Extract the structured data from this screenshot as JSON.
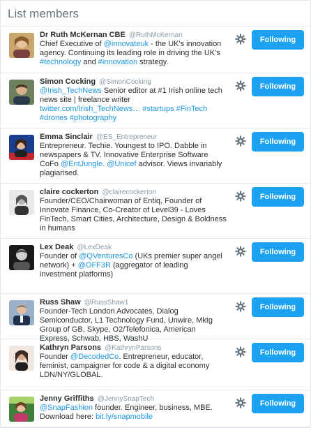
{
  "header": {
    "title": "List members"
  },
  "button_label": "Following",
  "colors": {
    "accent": "#1da1f2",
    "link": "#1b95e0",
    "handle": "#8899a6",
    "text": "#292f33"
  },
  "members": [
    {
      "name": "Dr Ruth McKernan CBE",
      "handle": "@RuthMcKernan",
      "bio": [
        [
          "Chief Executive of ",
          false
        ],
        [
          "@innovateuk",
          true
        ],
        [
          " - the UK's innovation agency. Continuing its leading role in driving the UK's ",
          false
        ],
        [
          "#technology",
          true
        ],
        [
          " and ",
          false
        ],
        [
          "#innovation",
          true
        ],
        [
          " strategy.",
          false
        ]
      ],
      "avatar_icon": "woman-portrait-avatar"
    },
    {
      "name": "Simon Cocking",
      "handle": "@SimonCocking",
      "bio": [
        [
          "@Irish_TechNews",
          true
        ],
        [
          " Senior editor at #1 Irish online tech news site | freelance writer ",
          false
        ],
        [
          "twitter.com/Irish_TechNews…",
          true
        ],
        [
          " ",
          false
        ],
        [
          "#startups",
          true
        ],
        [
          " ",
          false
        ],
        [
          "#FinTech",
          true
        ],
        [
          " ",
          false
        ],
        [
          "#drones",
          true
        ],
        [
          " ",
          false
        ],
        [
          "#photography",
          true
        ]
      ],
      "avatar_icon": "man-portrait-avatar"
    },
    {
      "name": "Emma Sinclair",
      "handle": "@ES_Entrepreneur",
      "bio": [
        [
          "Entrepreneur. Techie. Youngest to IPO. Dabble in newspapers & TV. Innovative Enterprise Software CoFo ",
          false
        ],
        [
          "@EntJungle",
          true
        ],
        [
          ". ",
          false
        ],
        [
          "@Unicef",
          true
        ],
        [
          " advisor. Views invariably plagiarised.",
          false
        ]
      ],
      "avatar_icon": "woman-tv-avatar"
    },
    {
      "name": "claire cockerton",
      "handle": "@clairecockerton",
      "bio": [
        [
          "Founder/CEO/Chairwoman of Entiq, Founder of Innovate Finance, Co-Creator of Level39 - Loves FinTech, Smart Cities, Architecture, Design & Boldness in humans",
          false
        ]
      ],
      "avatar_icon": "woman-bw-avatar"
    },
    {
      "name": "Lex Deak",
      "handle": "@LexDeak",
      "bio": [
        [
          "Founder of ",
          false
        ],
        [
          "@QVenturesCo",
          true
        ],
        [
          " (UKs premier super angel network) + ",
          false
        ],
        [
          "@OFF3R",
          true
        ],
        [
          " (aggregator of leading investment platforms)",
          false
        ]
      ],
      "avatar_icon": "man-bw-avatar"
    },
    {
      "name": "Russ Shaw",
      "handle": "@RussShaw1",
      "bio": [
        [
          "Founder-Tech London Advocates, Dialog Semiconductor, L1 Technology Fund, Unwire, Mktg Group of GB, Skype, O2/Telefonica, American Express, Schwab, HBS, WashU",
          false
        ]
      ],
      "avatar_icon": "man-suit-avatar"
    },
    {
      "name": "Kathryn Parsons",
      "handle": "@KathrynParsons",
      "bio": [
        [
          "Founder ",
          false
        ],
        [
          "@DecodedCo",
          true
        ],
        [
          ". Entrepreneur, educator, feminist, campaigner for code & a digital economy LDN/NY/GLOBAL.",
          false
        ]
      ],
      "avatar_icon": "woman-dark-avatar"
    },
    {
      "name": "Jenny Griffiths",
      "handle": "@JennySnapTech",
      "bio": [
        [
          "@SnapFashion",
          true
        ],
        [
          " founder. Engineer, business, MBE. Download here: ",
          false
        ],
        [
          "bit.ly/snapmobile",
          true
        ]
      ],
      "avatar_icon": "woman-stage-avatar"
    }
  ]
}
